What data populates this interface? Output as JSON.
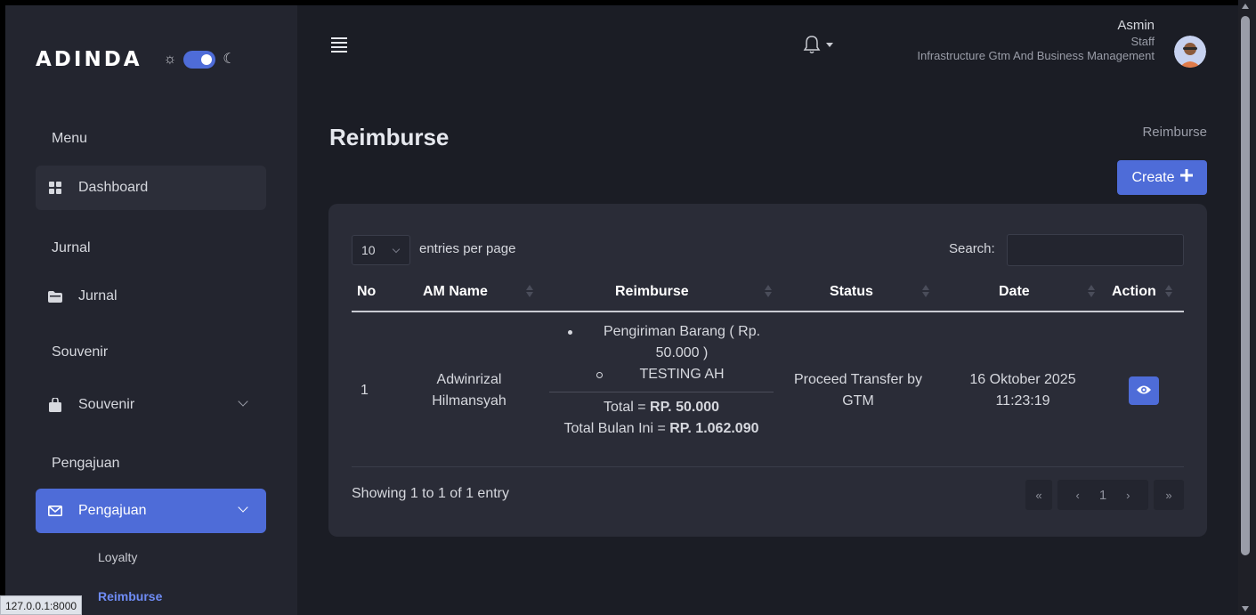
{
  "sidebar": {
    "logo": "ADINDA",
    "sections": {
      "menu": "Menu",
      "jurnal": "Jurnal",
      "souvenir": "Souvenir",
      "pengajuan": "Pengajuan"
    },
    "items": {
      "dashboard": "Dashboard",
      "jurnal": "Jurnal",
      "souvenir": "Souvenir",
      "pengajuan": "Pengajuan"
    },
    "subitems": {
      "loyalty": "Loyalty",
      "reimburse": "Reimburse"
    },
    "icons": {
      "theme_light": "sun-icon",
      "theme_dark": "moon-icon",
      "dashboard": "grid-icon",
      "jurnal": "folder-icon",
      "souvenir": "bag-icon",
      "pengajuan": "envelope-icon"
    }
  },
  "status_bar": {
    "url": "127.0.0.1:8000"
  },
  "topbar": {
    "user_name": "Asmin",
    "user_role": "Staff",
    "user_department": "Infrastructure Gtm And Business Management"
  },
  "page": {
    "title": "Reimburse",
    "breadcrumb": "Reimburse",
    "create_label": "Create"
  },
  "table": {
    "entries_value": "10",
    "entries_label": "entries per page",
    "search_label": "Search:",
    "search_value": "",
    "headers": {
      "no": "No",
      "am_name": "AM Name",
      "reimburse": "Reimburse",
      "status": "Status",
      "date": "Date",
      "action": "Action"
    },
    "rows": [
      {
        "no": "1",
        "am_name_1": "Adwinrizal",
        "am_name_2": "Hilmansyah",
        "item_1": "Pengiriman Barang ( Rp.",
        "item_2": "50.000 )",
        "sub_item": "TESTING AH",
        "total_label": "Total = ",
        "total_value": "RP. 50.000",
        "month_label": "Total Bulan Ini = ",
        "month_value": "RP. 1.062.090",
        "status_1": "Proceed Transfer by",
        "status_2": "GTM",
        "date_1": "16 Oktober 2025",
        "date_2": "11:23:19"
      }
    ],
    "footer": "Showing 1 to 1 of 1 entry",
    "pagination": {
      "first": "«",
      "prev": "‹",
      "current": "1",
      "next": "›",
      "last": "»"
    }
  },
  "colors": {
    "accent": "#4e6cd8",
    "sidebar_bg": "#23252f",
    "page_bg": "#1b1d25",
    "card_bg": "#2a2c37"
  }
}
